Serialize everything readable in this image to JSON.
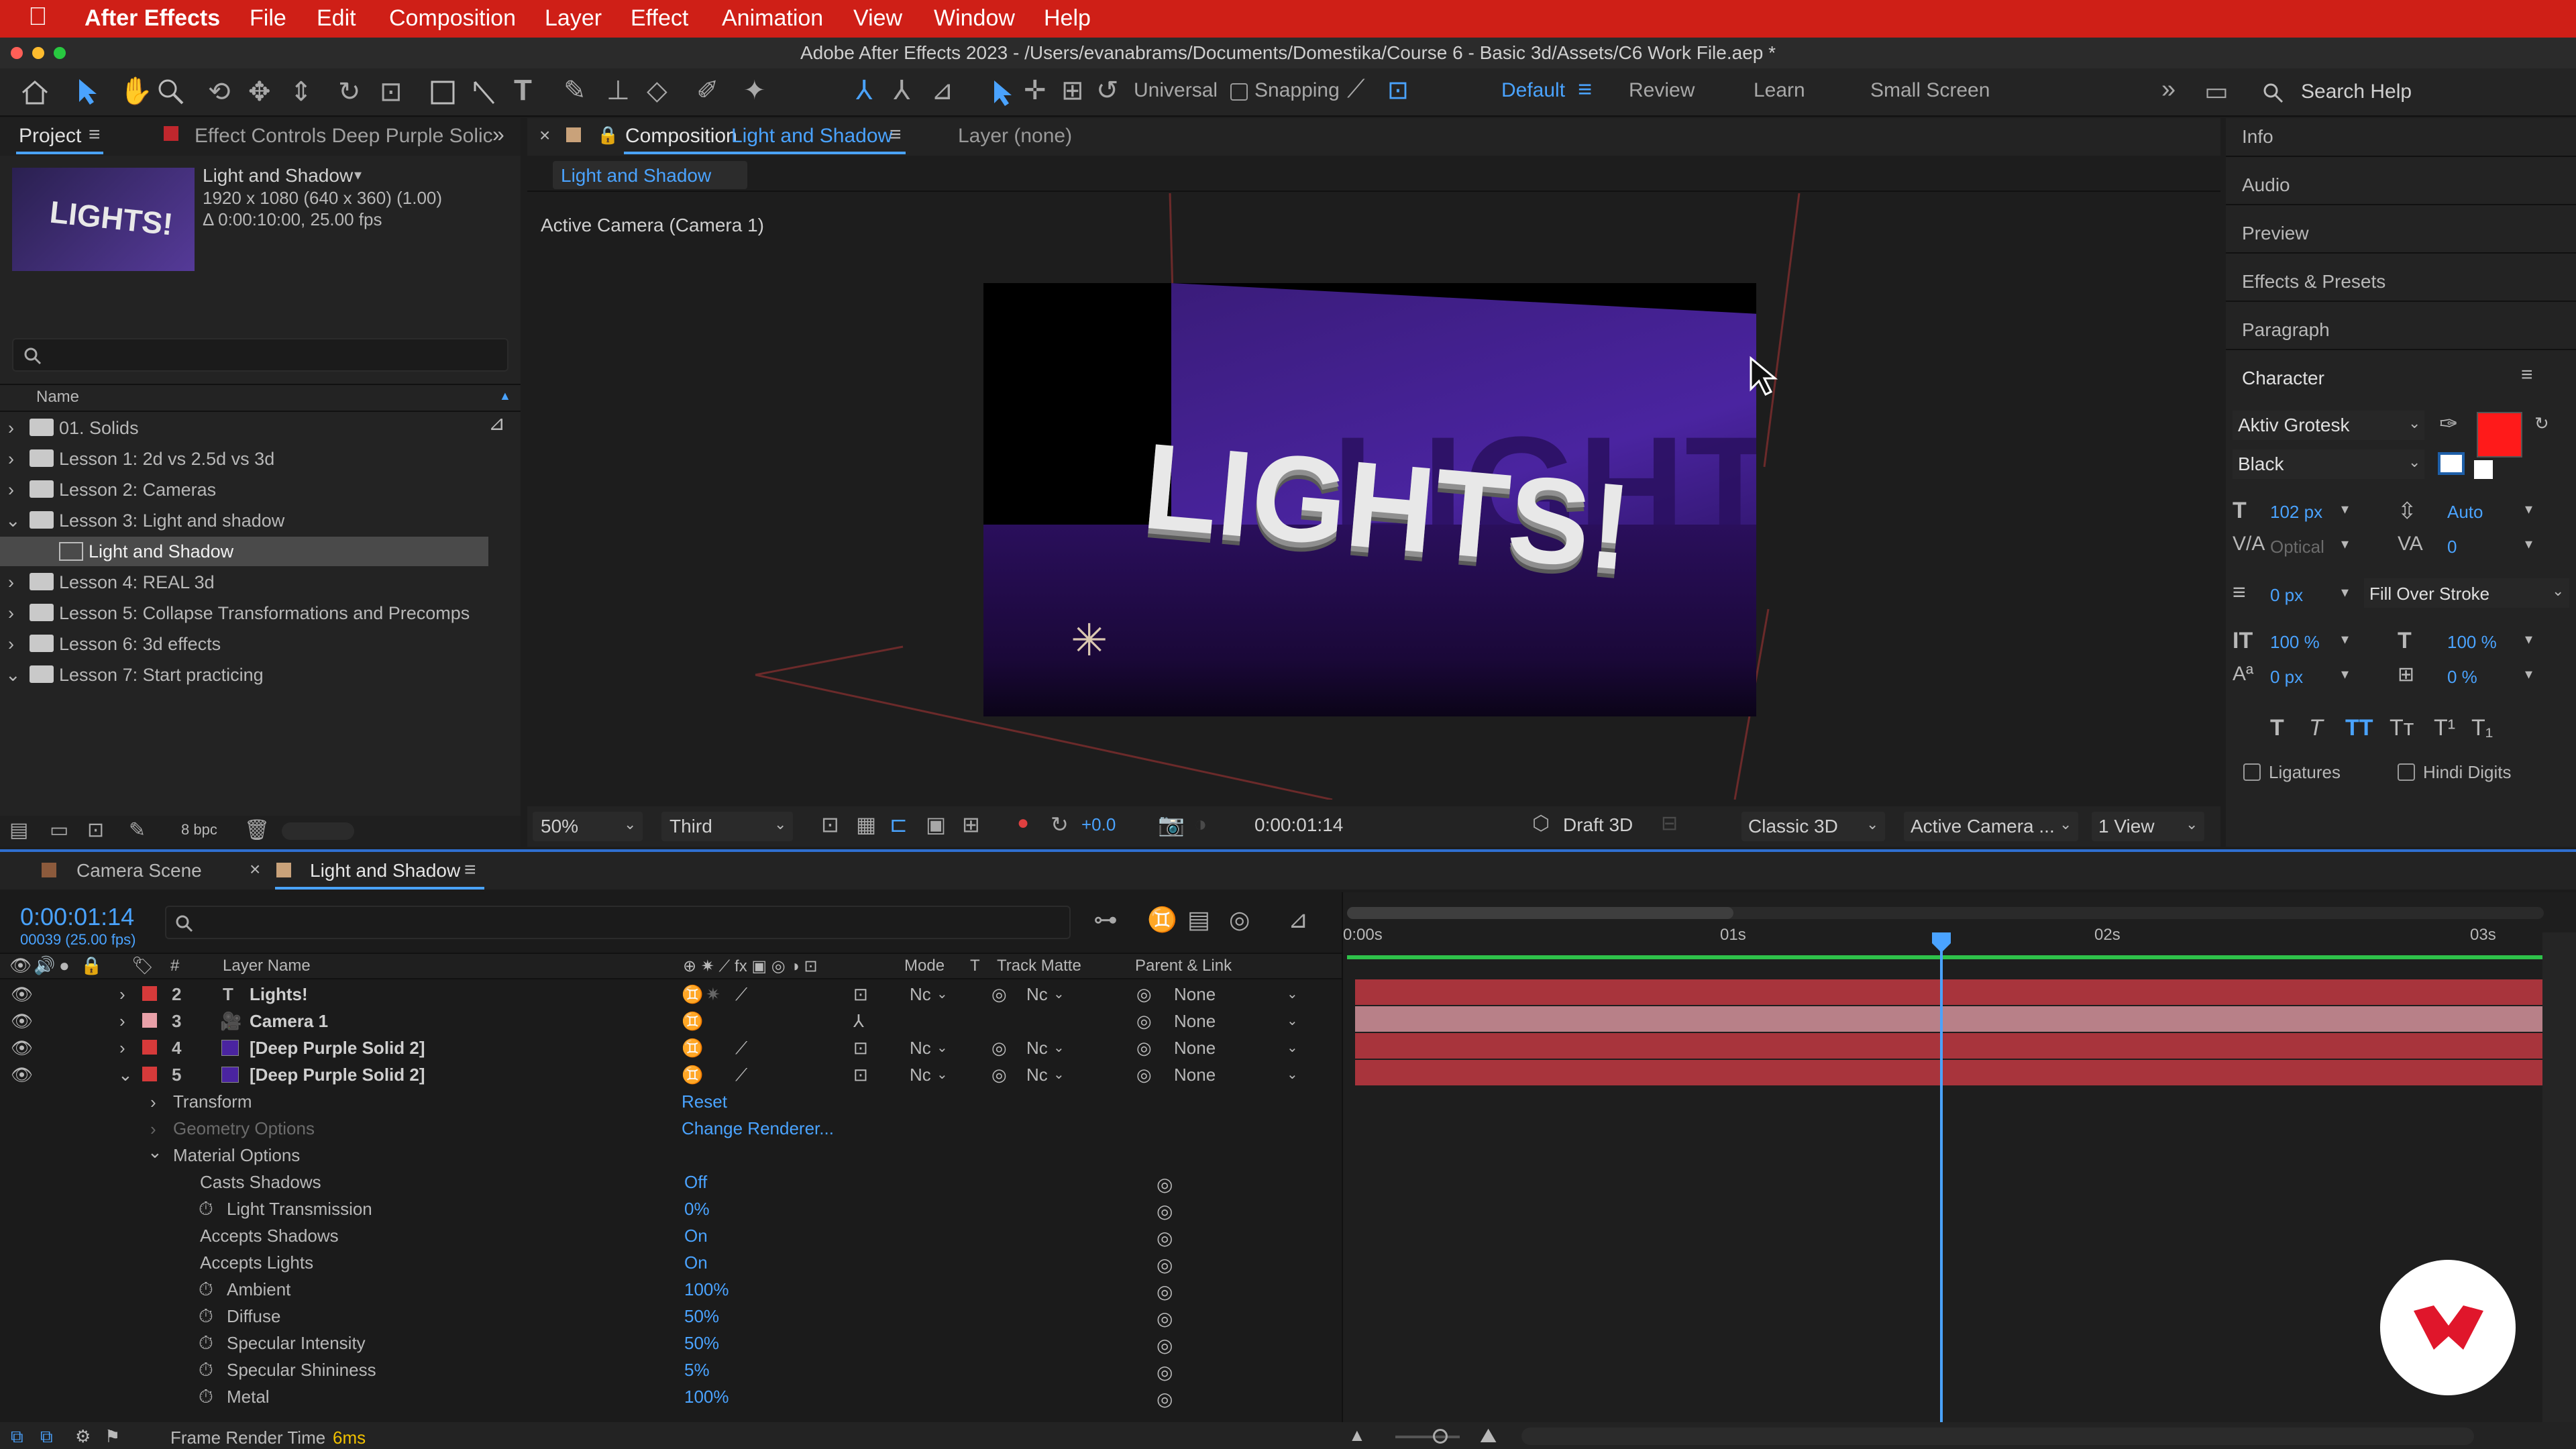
{
  "menubar": {
    "app": "After Effects",
    "items": [
      "File",
      "Edit",
      "Composition",
      "Layer",
      "Effect",
      "Animation",
      "View",
      "Window",
      "Help"
    ]
  },
  "window": {
    "title": "Adobe After Effects 2023 - /Users/evanabrams/Documents/Domestika/Course 6 - Basic 3d/Assets/C6 Work File.aep *"
  },
  "toolbar": {
    "axis_mode": "Universal",
    "snapping": "Snapping",
    "workspaces": [
      "Default",
      "Review",
      "Learn",
      "Small Screen"
    ],
    "search_placeholder": "Search Help"
  },
  "project": {
    "tab": "Project",
    "effect_controls_tab": "Effect Controls Deep Purple Solic",
    "thumb_text": "LIGHTS!",
    "comp_name": "Light and Shadow",
    "comp_info1": "1920 x 1080 (640 x 360) (1.00)",
    "comp_info2": "Δ 0:00:10:00, 25.00 fps",
    "column_name": "Name",
    "bpc": "8 bpc",
    "items": [
      "01. Solids",
      "Lesson 1: 2d vs 2.5d vs 3d",
      "Lesson 2: Cameras",
      "Lesson 3: Light and shadow",
      "Light and Shadow",
      "Lesson 4: REAL 3d",
      "Lesson 5: Collapse Transformations and Precomps",
      "Lesson 6: 3d effects",
      "Lesson 7: Start practicing"
    ]
  },
  "composition": {
    "tab_prefix": "Composition",
    "tab_name": "Light and Shadow",
    "layer_tab": "Layer (none)",
    "breadcrumb": "Light and Shadow",
    "camera_label": "Active Camera (Camera 1)",
    "canvas_text": "LIGHTS!",
    "bg_text": "LIGHTS!",
    "footer": {
      "zoom": "50%",
      "resolution": "Third",
      "exposure": "+0.0",
      "timecode": "0:00:01:14",
      "draft": "Draft 3D",
      "renderer": "Classic 3D",
      "camera": "Active Camera ...",
      "views": "1 View"
    }
  },
  "right": {
    "panels": [
      "Info",
      "Audio",
      "Preview",
      "Effects & Presets",
      "Paragraph"
    ],
    "character_title": "Character",
    "font": "Aktiv Grotesk",
    "style": "Black",
    "font_size": "102 px",
    "leading": "Auto",
    "kerning": "Optical",
    "tracking": "0",
    "stroke_width": "0 px",
    "stroke_mode": "Fill Over Stroke",
    "vscale": "100 %",
    "hscale": "100 %",
    "baseline": "0 px",
    "tsume": "0 %",
    "ligatures": "Ligatures",
    "hindi": "Hindi Digits",
    "fill_color": "#ff1a1a"
  },
  "timeline": {
    "tabs": [
      "Camera Scene",
      "Light and Shadow"
    ],
    "timecode": "0:00:01:14",
    "frame_info": "00039 (25.00 fps)",
    "columns": {
      "num": "#",
      "layer_name": "Layer Name",
      "mode": "Mode",
      "t": "T",
      "track_matte": "Track Matte",
      "parent": "Parent & Link"
    },
    "ruler": [
      "0:00s",
      "01s",
      "02s",
      "03s"
    ],
    "layers": [
      {
        "num": "2",
        "name": "Lights!",
        "mode": "Nc",
        "matte": "Nc",
        "parent": "None",
        "color": "#d63a3a"
      },
      {
        "num": "3",
        "name": "Camera 1",
        "mode": "",
        "matte": "",
        "parent": "None",
        "color": "#e8a0a8"
      },
      {
        "num": "4",
        "name": "[Deep Purple Solid 2]",
        "mode": "Nc",
        "matte": "Nc",
        "parent": "None",
        "color": "#d63a3a"
      },
      {
        "num": "5",
        "name": "[Deep Purple Solid 2]",
        "mode": "Nc",
        "matte": "Nc",
        "parent": "None",
        "color": "#d63a3a"
      }
    ],
    "props": [
      {
        "name": "Transform",
        "value": "Reset"
      },
      {
        "name": "Geometry Options",
        "value": "Change Renderer..."
      },
      {
        "name": "Material Options",
        "value": ""
      },
      {
        "name": "Casts Shadows",
        "value": "Off"
      },
      {
        "name": "Light Transmission",
        "value": "0%"
      },
      {
        "name": "Accepts Shadows",
        "value": "On"
      },
      {
        "name": "Accepts Lights",
        "value": "On"
      },
      {
        "name": "Ambient",
        "value": "100%"
      },
      {
        "name": "Diffuse",
        "value": "50%"
      },
      {
        "name": "Specular Intensity",
        "value": "50%"
      },
      {
        "name": "Specular Shininess",
        "value": "5%"
      },
      {
        "name": "Metal",
        "value": "100%"
      }
    ],
    "render_label": "Frame Render Time",
    "render_time": "6ms"
  }
}
